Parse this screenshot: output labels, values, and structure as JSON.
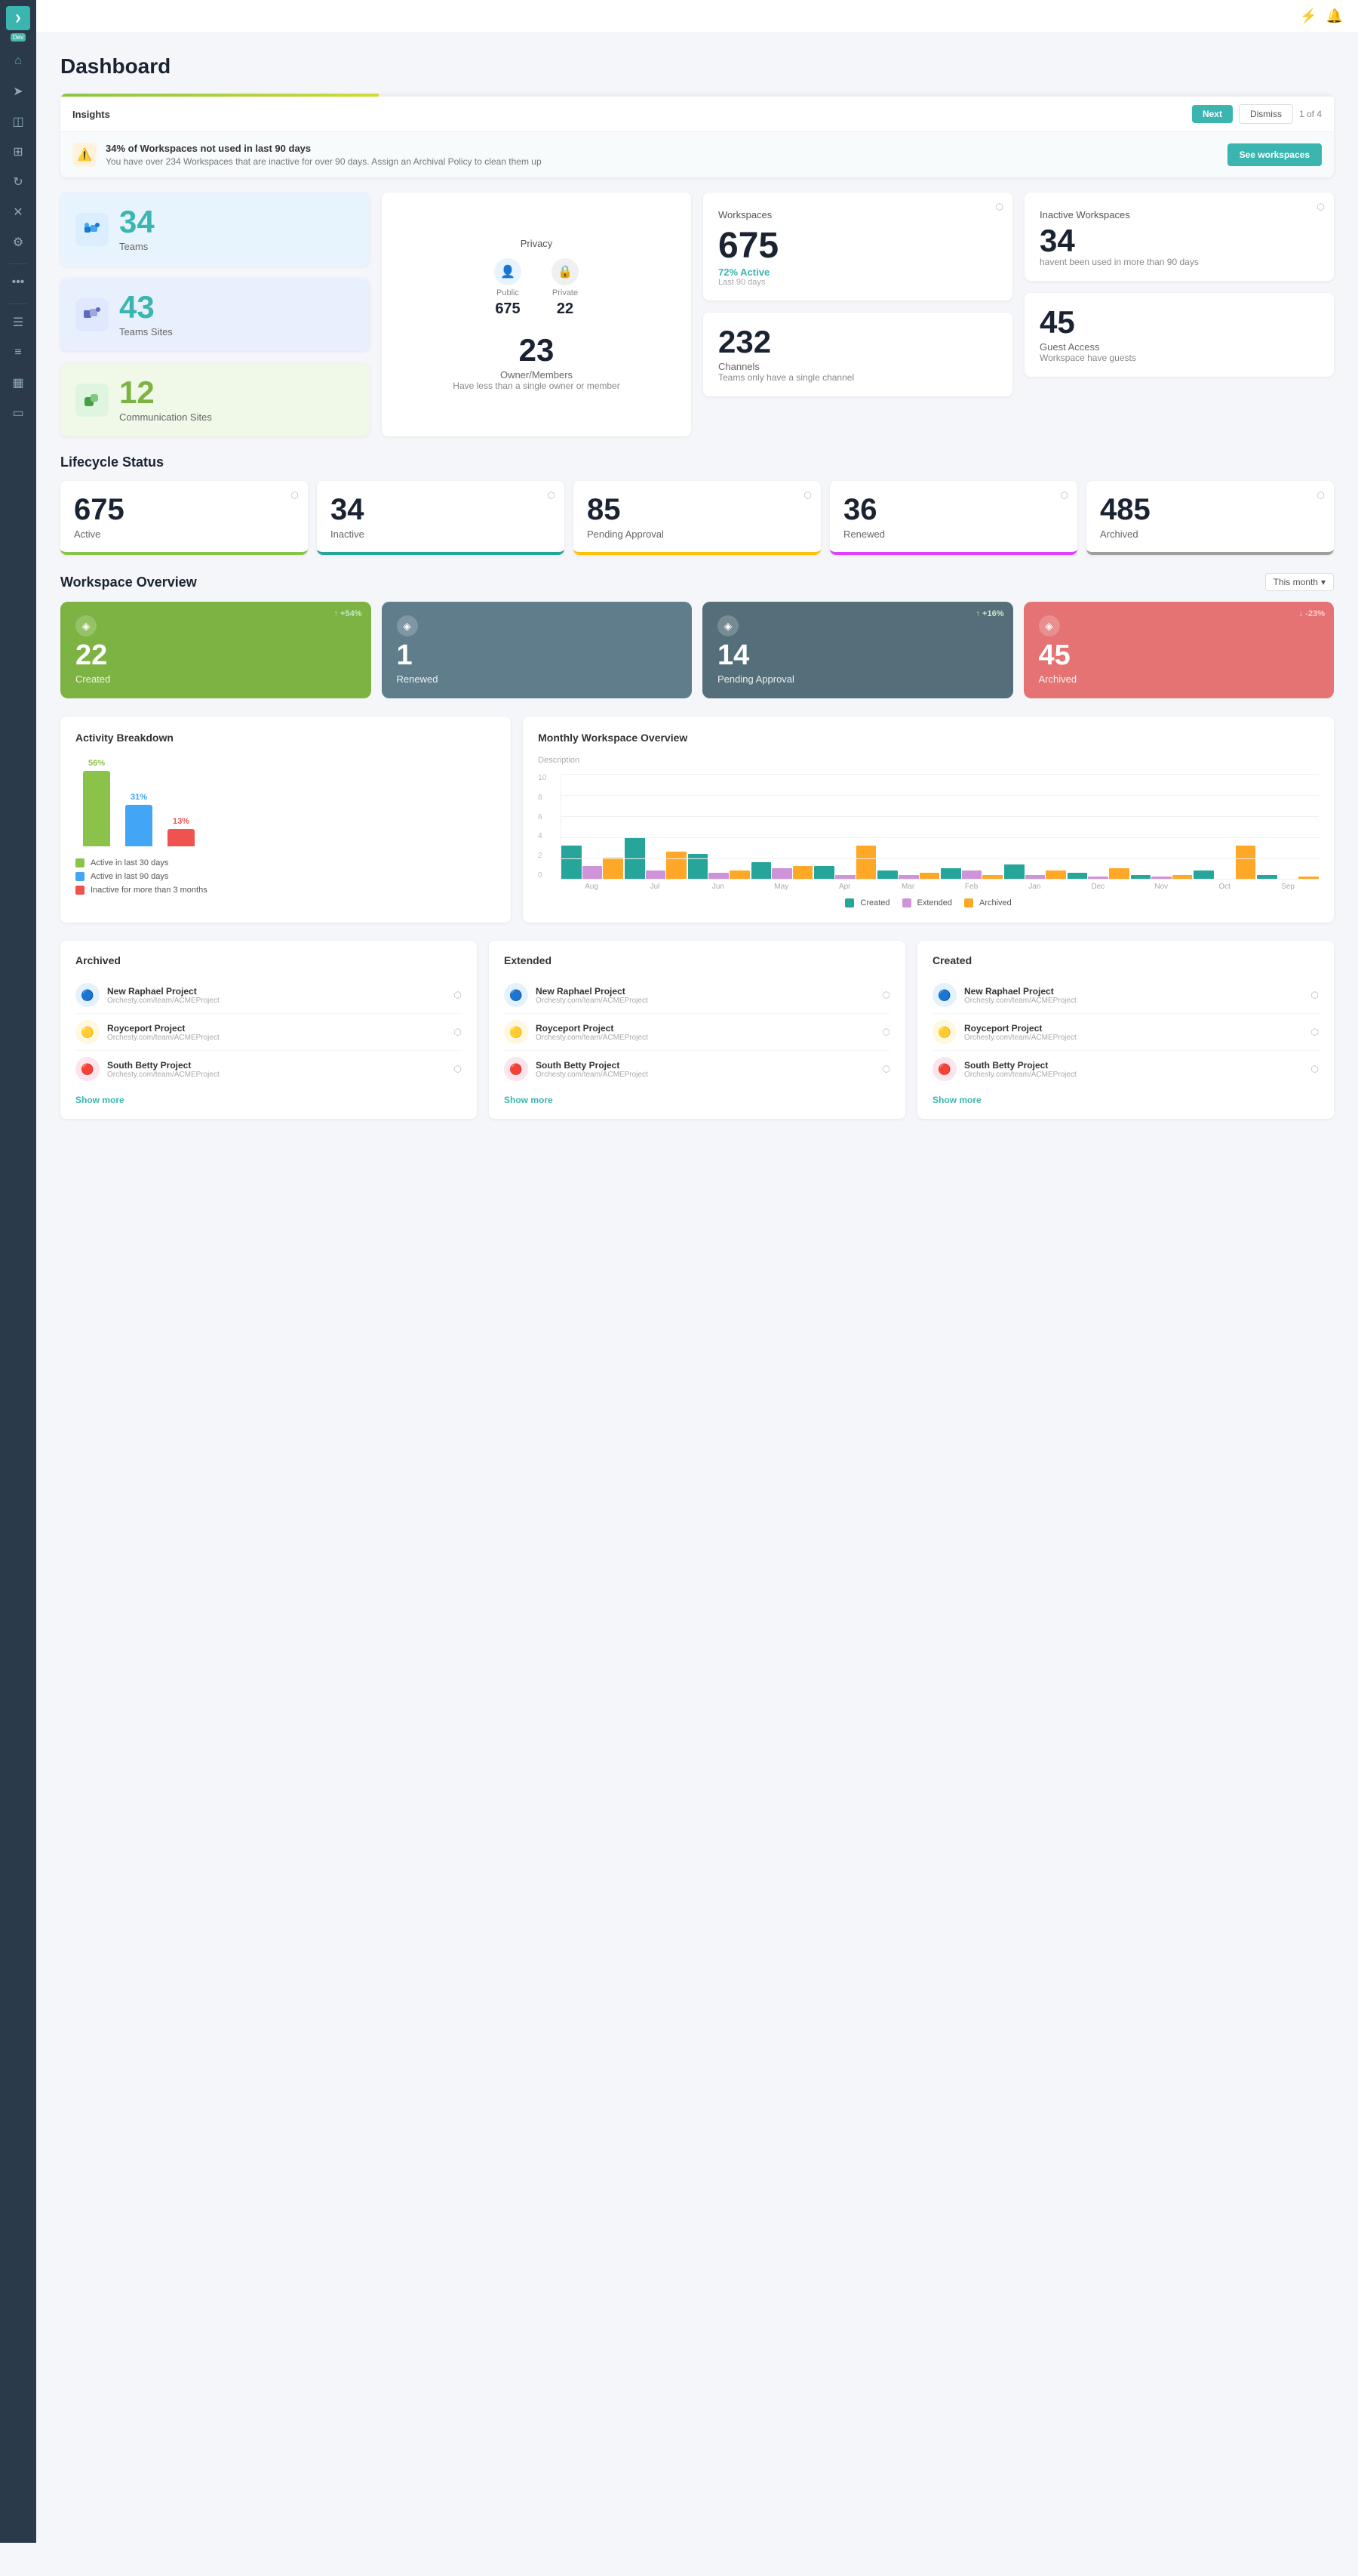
{
  "page": {
    "title": "Dashboard"
  },
  "topbar": {
    "lightning_icon": "⚡",
    "bell_icon": "🔔"
  },
  "sidebar": {
    "logo": "❯",
    "dev_label": "Dev",
    "icons": [
      {
        "name": "home-icon",
        "glyph": "⌂"
      },
      {
        "name": "send-icon",
        "glyph": "➤"
      },
      {
        "name": "layers-icon",
        "glyph": "◫"
      },
      {
        "name": "grid-icon",
        "glyph": "⊞"
      },
      {
        "name": "refresh-icon",
        "glyph": "↻"
      },
      {
        "name": "tools-icon",
        "glyph": "✕"
      },
      {
        "name": "settings-icon",
        "glyph": "⚙"
      },
      {
        "name": "more-icon",
        "glyph": "···"
      },
      {
        "name": "list-icon",
        "glyph": "☰"
      },
      {
        "name": "list2-icon",
        "glyph": "≡"
      },
      {
        "name": "chart-icon",
        "glyph": "📊"
      },
      {
        "name": "monitor-icon",
        "glyph": "🖥"
      }
    ]
  },
  "insights": {
    "title": "Insights",
    "next_btn": "Next",
    "dismiss_btn": "Dismiss",
    "count": "1 of 4",
    "warning_main": "34% of Workspaces not used in last 90 days",
    "warning_sub": "You have over 234 Workspaces that are inactive for over 90 days. Assign an Archival Policy to clean them up",
    "see_workspaces_btn": "See workspaces"
  },
  "stat_cards": {
    "teams": {
      "num": "34",
      "label": "Teams"
    },
    "teams_sites": {
      "num": "43",
      "label": "Teams Sites"
    },
    "comm_sites": {
      "num": "12",
      "label": "Communication Sites"
    },
    "privacy": {
      "title": "Privacy",
      "public_label": "Public",
      "public_num": "675",
      "private_label": "Private",
      "private_num": "22"
    },
    "workspaces": {
      "title": "Workspaces",
      "num": "675",
      "active_pct": "72% Active",
      "last_days": "Last 90 days"
    },
    "inactive_workspaces": {
      "title": "Inactive Workspaces",
      "num": "34",
      "desc": "havent been used in more than 90 days"
    },
    "owner_members": {
      "num": "23",
      "label": "Owner/Members",
      "desc": "Have less than a single owner or member"
    },
    "channels": {
      "num": "232",
      "label": "Channels",
      "desc": "Teams only have a single channel"
    },
    "guest_access": {
      "num": "45",
      "label": "Guest Access",
      "desc": "Workspace have guests"
    }
  },
  "lifecycle": {
    "section_title": "Lifecycle Status",
    "cards": [
      {
        "num": "675",
        "label": "Active",
        "border": "active-border"
      },
      {
        "num": "34",
        "label": "Inactive",
        "border": "inactive-border"
      },
      {
        "num": "85",
        "label": "Pending Approval",
        "border": "pending-border"
      },
      {
        "num": "36",
        "label": "Renewed",
        "border": "renewed-border"
      },
      {
        "num": "485",
        "label": "Archived",
        "border": "archived-border"
      }
    ]
  },
  "workspace_overview": {
    "section_title": "Workspace Overview",
    "month_select": "This month",
    "cards": [
      {
        "num": "22",
        "label": "Created",
        "badge": "↑ +54%",
        "badge_type": "up",
        "color": "green-card"
      },
      {
        "num": "1",
        "label": "Renewed",
        "badge": "",
        "badge_type": "",
        "color": "gray-card"
      },
      {
        "num": "14",
        "label": "Pending Approval",
        "badge": "↑ +16%",
        "badge_type": "up",
        "color": "dark-card"
      },
      {
        "num": "45",
        "label": "Archived",
        "badge": "↓ -23%",
        "badge_type": "down",
        "color": "red-card"
      }
    ]
  },
  "activity_breakdown": {
    "title": "Activity Breakdown",
    "bars": [
      {
        "pct_label": "56%",
        "color": "green",
        "height": 100
      },
      {
        "pct_label": "31%",
        "color": "blue",
        "height": 55
      },
      {
        "pct_label": "13%",
        "color": "red",
        "height": 23
      }
    ],
    "legend": [
      {
        "color": "#8bc34a",
        "label": "Active in last 30 days"
      },
      {
        "color": "#42a5f5",
        "label": "Active in last 90 days"
      },
      {
        "color": "#ef5350",
        "label": "Inactive for more than 3 months"
      }
    ]
  },
  "monthly_overview": {
    "title": "Monthly Workspace Overview",
    "subtitle": "Description",
    "y_axis": [
      "10",
      "8",
      "6",
      "4",
      "2",
      "0"
    ],
    "months": [
      "Aug",
      "Jul",
      "Jun",
      "May",
      "Apr",
      "Mar",
      "Feb",
      "Jan",
      "Dec",
      "Nov",
      "Oct",
      "Sep"
    ],
    "bars_data": [
      {
        "created": 80,
        "extended": 30,
        "archived": 50
      },
      {
        "created": 90,
        "extended": 20,
        "archived": 60
      },
      {
        "created": 50,
        "extended": 15,
        "archived": 20
      },
      {
        "created": 40,
        "extended": 25,
        "archived": 30
      },
      {
        "created": 30,
        "extended": 10,
        "archived": 70
      },
      {
        "created": 20,
        "extended": 10,
        "archived": 15
      },
      {
        "created": 25,
        "extended": 20,
        "archived": 10
      },
      {
        "created": 35,
        "extended": 10,
        "archived": 20
      },
      {
        "created": 15,
        "extended": 5,
        "archived": 25
      },
      {
        "created": 10,
        "extended": 5,
        "archived": 10
      },
      {
        "created": 20,
        "extended": 0,
        "archived": 70
      },
      {
        "created": 10,
        "extended": 0,
        "archived": 5
      }
    ],
    "legend": [
      {
        "color": "#26a69a",
        "label": "Created"
      },
      {
        "color": "#ce93d8",
        "label": "Extended"
      },
      {
        "color": "#ffa726",
        "label": "Archived"
      }
    ]
  },
  "archived_list": {
    "title": "Archived",
    "items": [
      {
        "name": "New Raphael Project",
        "url": "Orchesty.com/team/ACMEProject",
        "avatar_bg": "#e3f2fd",
        "avatar": "🔵"
      },
      {
        "name": "Royceport Project",
        "url": "Orchesty.com/team/ACMEProject",
        "avatar_bg": "#fff8e1",
        "avatar": "🟡"
      },
      {
        "name": "South Betty Project",
        "url": "Orchesty.com/team/ACMEProject",
        "avatar_bg": "#fce4ec",
        "avatar": "🔴"
      }
    ],
    "show_more": "Show more"
  },
  "extended_list": {
    "title": "Extended",
    "items": [
      {
        "name": "New Raphael Project",
        "url": "Orchesty.com/team/ACMEProject",
        "avatar_bg": "#e3f2fd",
        "avatar": "🔵"
      },
      {
        "name": "Royceport Project",
        "url": "Orchesty.com/team/ACMEProject",
        "avatar_bg": "#fff8e1",
        "avatar": "🟡"
      },
      {
        "name": "South Betty Project",
        "url": "Orchesty.com/team/ACMEProject",
        "avatar_bg": "#fce4ec",
        "avatar": "🔴"
      }
    ],
    "show_more": "Show more"
  },
  "created_list": {
    "title": "Created",
    "items": [
      {
        "name": "New Raphael Project",
        "url": "Orchesty.com/team/ACMEProject",
        "avatar_bg": "#e3f2fd",
        "avatar": "🔵"
      },
      {
        "name": "Royceport Project",
        "url": "Orchesty.com/team/ACMEProject",
        "avatar_bg": "#fff8e1",
        "avatar": "🟡"
      },
      {
        "name": "South Betty Project",
        "url": "Orchesty.com/team/ACMEProject",
        "avatar_bg": "#fce4ec",
        "avatar": "🔴"
      }
    ],
    "show_more": "Show more"
  }
}
